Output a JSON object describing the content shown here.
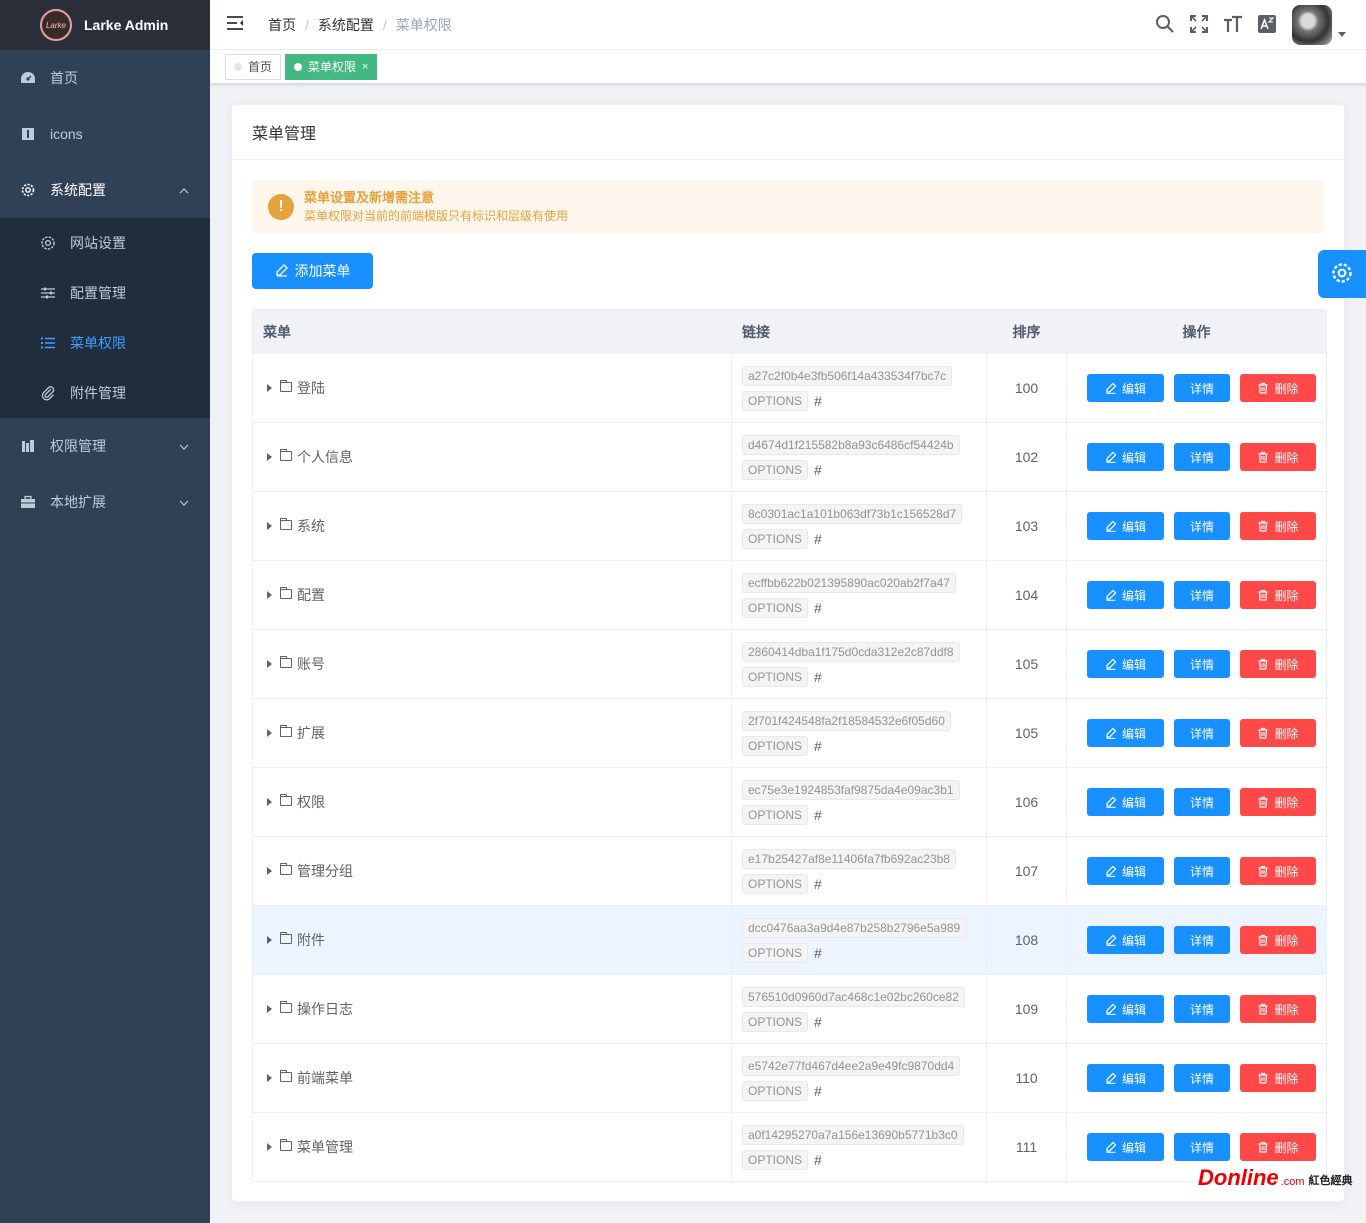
{
  "app": {
    "logo_text": "Larke",
    "title": "Larke Admin"
  },
  "sidebar": {
    "items": [
      {
        "label": "首页",
        "icon": "dashboard-icon"
      },
      {
        "label": "icons",
        "icon": "info-icon"
      },
      {
        "label": "系统配置",
        "icon": "gear-icon",
        "expanded": true
      },
      {
        "label": "权限管理",
        "icon": "bars-icon"
      },
      {
        "label": "本地扩展",
        "icon": "briefcase-icon"
      }
    ],
    "sub_items": [
      {
        "label": "网站设置",
        "icon": "cog-icon"
      },
      {
        "label": "配置管理",
        "icon": "sliders-icon"
      },
      {
        "label": "菜单权限",
        "icon": "list-icon",
        "active": true
      },
      {
        "label": "附件管理",
        "icon": "paperclip-icon"
      }
    ]
  },
  "breadcrumb": [
    "首页",
    "系统配置",
    "菜单权限"
  ],
  "tags": [
    {
      "label": "首页",
      "active": false
    },
    {
      "label": "菜单权限",
      "active": true,
      "close": "×"
    }
  ],
  "card": {
    "title": "菜单管理",
    "alert_title": "菜单设置及新增需注意",
    "alert_desc": "菜单权限对当前的前端模版只有标识和层级有使用",
    "alert_icon": "!",
    "add_button": "添加菜单"
  },
  "table": {
    "headers": {
      "menu": "菜单",
      "link": "链接",
      "sort": "排序",
      "ops": "操作"
    },
    "buttons": {
      "edit": "编辑",
      "detail": "详情",
      "delete": "删除"
    },
    "rows": [
      {
        "name": "登陆",
        "slug": "a27c2f0b4e3fb506f14a433534f7bc7c",
        "method": "OPTIONS",
        "path": "#",
        "sort": "100"
      },
      {
        "name": "个人信息",
        "slug": "d4674d1f215582b8a93c6486cf54424b",
        "method": "OPTIONS",
        "path": "#",
        "sort": "102"
      },
      {
        "name": "系统",
        "slug": "8c0301ac1a101b063df73b1c156528d7",
        "method": "OPTIONS",
        "path": "#",
        "sort": "103"
      },
      {
        "name": "配置",
        "slug": "ecffbb622b021395890ac020ab2f7a47",
        "method": "OPTIONS",
        "path": "#",
        "sort": "104"
      },
      {
        "name": "账号",
        "slug": "2860414dba1f175d0cda312e2c87ddf8",
        "method": "OPTIONS",
        "path": "#",
        "sort": "105"
      },
      {
        "name": "扩展",
        "slug": "2f701f424548fa2f18584532e6f05d60",
        "method": "OPTIONS",
        "path": "#",
        "sort": "105"
      },
      {
        "name": "权限",
        "slug": "ec75e3e1924853faf9875da4e09ac3b1",
        "method": "OPTIONS",
        "path": "#",
        "sort": "106"
      },
      {
        "name": "管理分组",
        "slug": "e17b25427af8e11406fa7fb692ac23b8",
        "method": "OPTIONS",
        "path": "#",
        "sort": "107"
      },
      {
        "name": "附件",
        "slug": "dcc0476aa3a9d4e87b258b2796e5a989",
        "method": "OPTIONS",
        "path": "#",
        "sort": "108",
        "highlight": true
      },
      {
        "name": "操作日志",
        "slug": "576510d0960d7ac468c1e02bc260ce82",
        "method": "OPTIONS",
        "path": "#",
        "sort": "109"
      },
      {
        "name": "前端菜单",
        "slug": "e5742e77fd467d4ee2a9e49fc9870dd4",
        "method": "OPTIONS",
        "path": "#",
        "sort": "110"
      },
      {
        "name": "菜单管理",
        "slug": "a0f14295270a7a156e13690b5771b3c0",
        "method": "OPTIONS",
        "path": "#",
        "sort": "111"
      }
    ]
  },
  "watermark": {
    "logo": "Donline",
    "domain": ".com",
    "cn": "紅色經典"
  },
  "colors": {
    "primary": "#1890ff",
    "danger": "#ff4949",
    "sidebar": "#304156",
    "warning": "#e6a23c",
    "tag_active": "#42b983"
  }
}
